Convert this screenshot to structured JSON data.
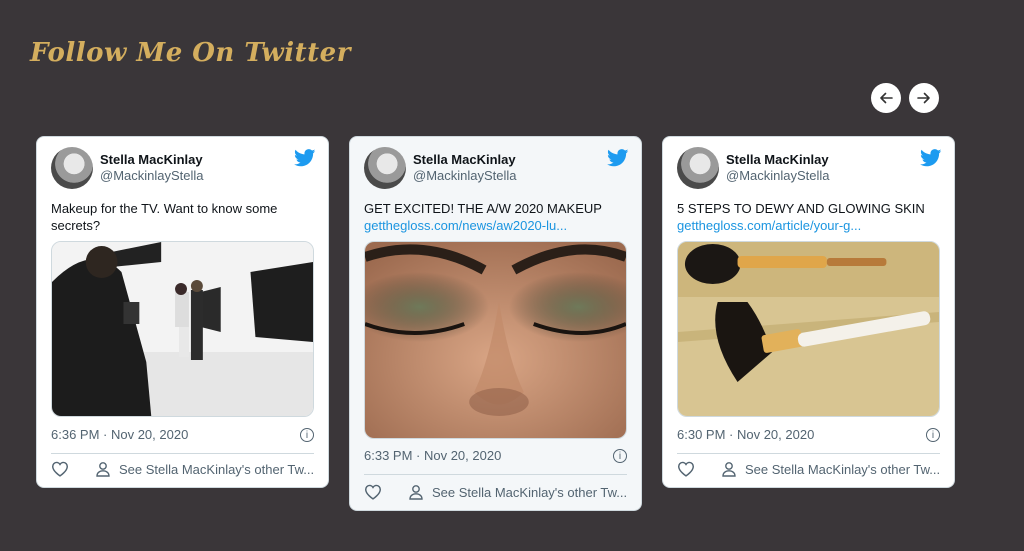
{
  "header": {
    "title": "Follow Me On Twitter"
  },
  "tweets": [
    {
      "name": "Stella MacKinlay",
      "handle": "@MackinlayStella",
      "text": "Makeup for the TV. Want to know some secrets?",
      "link": "",
      "media": "photo-studio-shoot",
      "timestamp": "6:36 PM · Nov 20, 2020",
      "other": "See Stella MacKinlay's other Tw..."
    },
    {
      "name": "Stella MacKinlay",
      "handle": "@MackinlayStella",
      "text": "GET EXCITED! THE A/W 2020 MAKEUP",
      "link": "getthegloss.com/news/aw2020-lu...",
      "media": "eye-makeup-closeup",
      "timestamp": "6:33 PM · Nov 20, 2020",
      "other": "See Stella MacKinlay's other Tw..."
    },
    {
      "name": "Stella MacKinlay",
      "handle": "@MackinlayStella",
      "text": "5 STEPS TO DEWY AND GLOWING SKIN",
      "link": "getthegloss.com/article/your-g...",
      "media": "makeup-brushes",
      "timestamp": "6:30 PM · Nov 20, 2020",
      "other": "See Stella MacKinlay's other Tw..."
    }
  ],
  "nav": {
    "prev_icon": "arrow-left-icon",
    "next_icon": "arrow-right-icon"
  },
  "colors": {
    "background": "#3a3639",
    "title": "#d4ae5e",
    "twitter_blue": "#1d9bf0",
    "link": "#1b95e0"
  }
}
